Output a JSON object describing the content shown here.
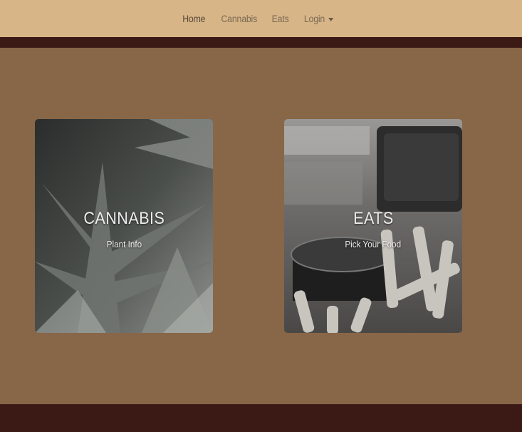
{
  "nav": {
    "items": [
      {
        "label": "Home"
      },
      {
        "label": "Cannabis"
      },
      {
        "label": "Eats"
      },
      {
        "label": "Login"
      }
    ]
  },
  "cards": [
    {
      "title": "CANNABIS",
      "subtitle": "Plant Info",
      "image": "cannabis-leaf-photo"
    },
    {
      "title": "EATS",
      "subtitle": "Pick Your Food",
      "image": "fries-and-sauce-photo"
    }
  ],
  "colors": {
    "navbar_bg": "#d7b587",
    "page_bg": "#876748",
    "band": "#3b1a15",
    "nav_text": "#7b6a56"
  }
}
